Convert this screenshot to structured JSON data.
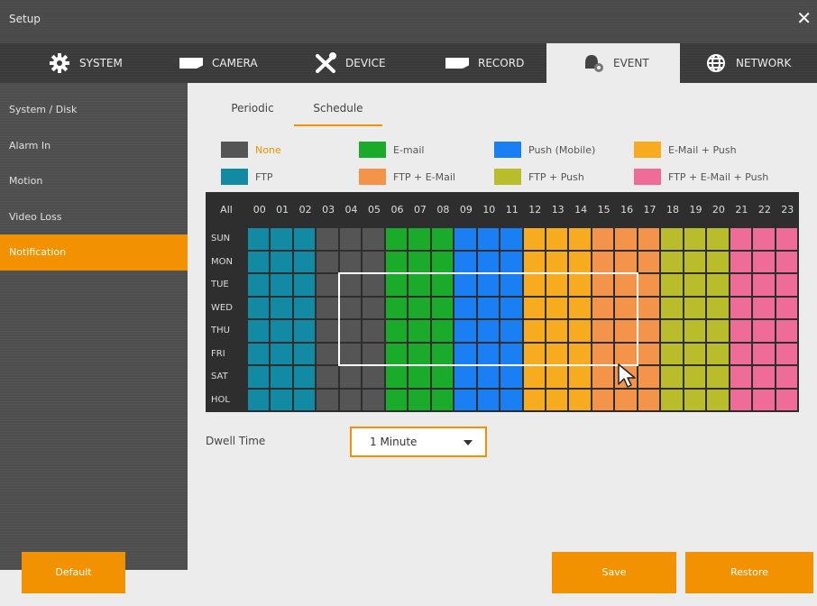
{
  "window": {
    "title": "Setup",
    "close_icon": "close-icon"
  },
  "tabs": [
    {
      "label": "SYSTEM",
      "icon": "gear-icon"
    },
    {
      "label": "CAMERA",
      "icon": "camera-icon"
    },
    {
      "label": "DEVICE",
      "icon": "tools-icon"
    },
    {
      "label": "RECORD",
      "icon": "record-icon"
    },
    {
      "label": "EVENT",
      "icon": "bell-icon",
      "active": true
    },
    {
      "label": "NETWORK",
      "icon": "globe-icon"
    }
  ],
  "sidebar": {
    "items": [
      {
        "label": "System / Disk"
      },
      {
        "label": "Alarm In"
      },
      {
        "label": "Motion"
      },
      {
        "label": "Video Loss"
      },
      {
        "label": "Notification",
        "active": true
      }
    ]
  },
  "subtabs": [
    {
      "label": "Periodic"
    },
    {
      "label": "Schedule",
      "active": true
    }
  ],
  "legend": [
    {
      "label": "None",
      "color": "#555555",
      "label_color": "#f39200"
    },
    {
      "label": "E-mail",
      "color": "#1aab2b"
    },
    {
      "label": "Push (Mobile)",
      "color": "#1a7ff2"
    },
    {
      "label": "E-Mail + Push",
      "color": "#f7ab1f"
    },
    {
      "label": "FTP",
      "color": "#138aa3"
    },
    {
      "label": "FTP + E-Mail",
      "color": "#f4944a"
    },
    {
      "label": "FTP + Push",
      "color": "#b9bd2b"
    },
    {
      "label": "FTP + E-Mail + Push",
      "color": "#ef6c98"
    }
  ],
  "schedule": {
    "all_label": "All",
    "hours": [
      "00",
      "01",
      "02",
      "03",
      "04",
      "05",
      "06",
      "07",
      "08",
      "09",
      "10",
      "11",
      "12",
      "13",
      "14",
      "15",
      "16",
      "17",
      "18",
      "19",
      "20",
      "21",
      "22",
      "23"
    ],
    "days": [
      "SUN",
      "MON",
      "TUE",
      "WED",
      "THU",
      "FRI",
      "SAT",
      "HOL"
    ],
    "hour_assignment": [
      "FTP",
      "FTP",
      "FTP",
      "None",
      "None",
      "None",
      "E-mail",
      "E-mail",
      "E-mail",
      "Push (Mobile)",
      "Push (Mobile)",
      "Push (Mobile)",
      "E-Mail + Push",
      "E-Mail + Push",
      "E-Mail + Push",
      "FTP + E-Mail",
      "FTP + E-Mail",
      "FTP + E-Mail",
      "FTP + Push",
      "FTP + Push",
      "FTP + Push",
      "FTP + E-Mail + Push",
      "FTP + E-Mail + Push",
      "FTP + E-Mail + Push"
    ]
  },
  "dwell": {
    "label": "Dwell Time",
    "value": "1 Minute"
  },
  "buttons": {
    "default": "Default",
    "save": "Save",
    "restore": "Restore"
  }
}
